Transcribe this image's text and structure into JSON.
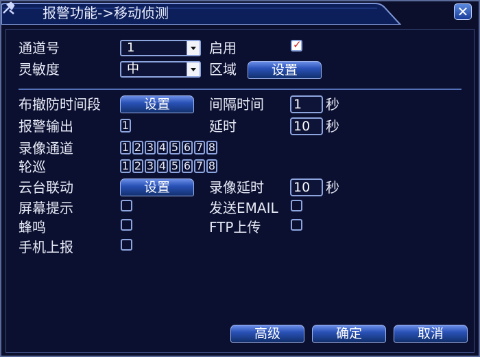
{
  "window": {
    "title": "报警功能->移动侦测",
    "close_label": "✕"
  },
  "channel": {
    "label": "通道号",
    "value": "1"
  },
  "enable": {
    "label": "启用",
    "checked": true
  },
  "sensitivity": {
    "label": "灵敏度",
    "value": "中"
  },
  "region": {
    "label": "区域",
    "button": "设置"
  },
  "schedule": {
    "label": "布撤防时间段",
    "button": "设置"
  },
  "interval": {
    "label": "间隔时间",
    "value": "1",
    "unit": "秒"
  },
  "alarm_output": {
    "label": "报警输出",
    "channels": [
      "1"
    ]
  },
  "delay": {
    "label": "延时",
    "value": "10",
    "unit": "秒"
  },
  "record_channel": {
    "label": "录像通道",
    "channels": [
      "1",
      "2",
      "3",
      "4",
      "5",
      "6",
      "7",
      "8"
    ]
  },
  "tour": {
    "label": "轮巡",
    "channels": [
      "1",
      "2",
      "3",
      "4",
      "5",
      "6",
      "7",
      "8"
    ]
  },
  "ptz": {
    "label": "云台联动",
    "button": "设置"
  },
  "record_delay": {
    "label": "录像延时",
    "value": "10",
    "unit": "秒"
  },
  "screen_tip": {
    "label": "屏幕提示",
    "checked": false
  },
  "send_email": {
    "label": "发送EMAIL",
    "checked": false
  },
  "buzzer": {
    "label": "蜂鸣",
    "checked": false
  },
  "ftp_upload": {
    "label": "FTP上传",
    "checked": false
  },
  "mobile_report": {
    "label": "手机上报",
    "checked": false
  },
  "footer": {
    "advanced": "高级",
    "ok": "确定",
    "cancel": "取消"
  }
}
